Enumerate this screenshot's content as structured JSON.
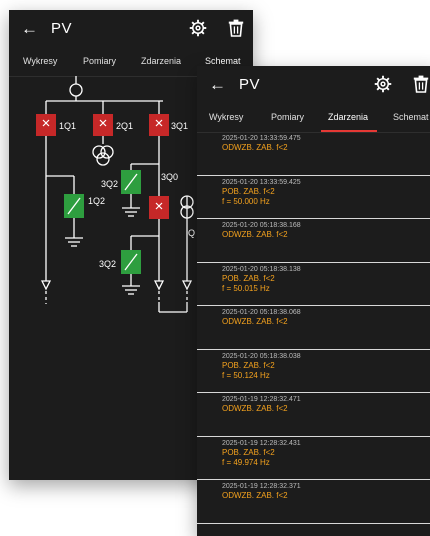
{
  "back_screen": {
    "appbar": {
      "title": "PV",
      "back_icon": "arrow-left-icon",
      "settings_icon": "gear-icon",
      "delete_icon": "trash-icon"
    },
    "tabs": [
      {
        "label": "Wykresy"
      },
      {
        "label": "Pomiary"
      },
      {
        "label": "Zdarzenia"
      },
      {
        "label": "Schemat",
        "active": true
      }
    ],
    "schematic": {
      "labels": {
        "q1": "1Q1",
        "q2": "2Q1",
        "q3": "3Q1",
        "q4": "3Q2",
        "q5": "1Q2",
        "q6": "3Q0",
        "q7": "3Q2",
        "q8": "Q"
      },
      "colors": {
        "closed": "#c62828",
        "open": "#2e9e3f",
        "line": "#ffffff"
      }
    }
  },
  "front_screen": {
    "appbar": {
      "title": "PV",
      "back_icon": "arrow-left-icon",
      "settings_icon": "gear-icon",
      "delete_icon": "trash-icon"
    },
    "tabs": [
      {
        "label": "Wykresy"
      },
      {
        "label": "Pomiary"
      },
      {
        "label": "Zdarzenia",
        "active": true
      },
      {
        "label": "Schemat"
      }
    ],
    "accent_color": "#e53935",
    "event_text_color": "#f4a21e",
    "events": [
      {
        "timestamp": "2025-01-20 13:33:59.475",
        "lines": [
          "ODWZB. ZAB. f<2"
        ]
      },
      {
        "timestamp": "2025-01-20 13:33:59.425",
        "lines": [
          "POB. ZAB. f<2",
          "f = 50.000 Hz"
        ]
      },
      {
        "timestamp": "2025-01-20 05:18:38.168",
        "lines": [
          "ODWZB. ZAB. f<2"
        ]
      },
      {
        "timestamp": "2025-01-20 05:18:38.138",
        "lines": [
          "POB. ZAB. f<2",
          "f = 50.015 Hz"
        ]
      },
      {
        "timestamp": "2025-01-20 05:18:38.068",
        "lines": [
          "ODWZB. ZAB. f<2"
        ]
      },
      {
        "timestamp": "2025-01-20 05:18:38.038",
        "lines": [
          "POB. ZAB. f<2",
          "f = 50.124 Hz"
        ]
      },
      {
        "timestamp": "2025-01-19 12:28:32.471",
        "lines": [
          "ODWZB. ZAB. f<2"
        ]
      },
      {
        "timestamp": "2025-01-19 12:28:32.431",
        "lines": [
          "POB. ZAB. f<2",
          "f = 49.974 Hz"
        ]
      },
      {
        "timestamp": "2025-01-19 12:28:32.371",
        "lines": [
          "ODWZB. ZAB. f<2"
        ]
      }
    ]
  }
}
